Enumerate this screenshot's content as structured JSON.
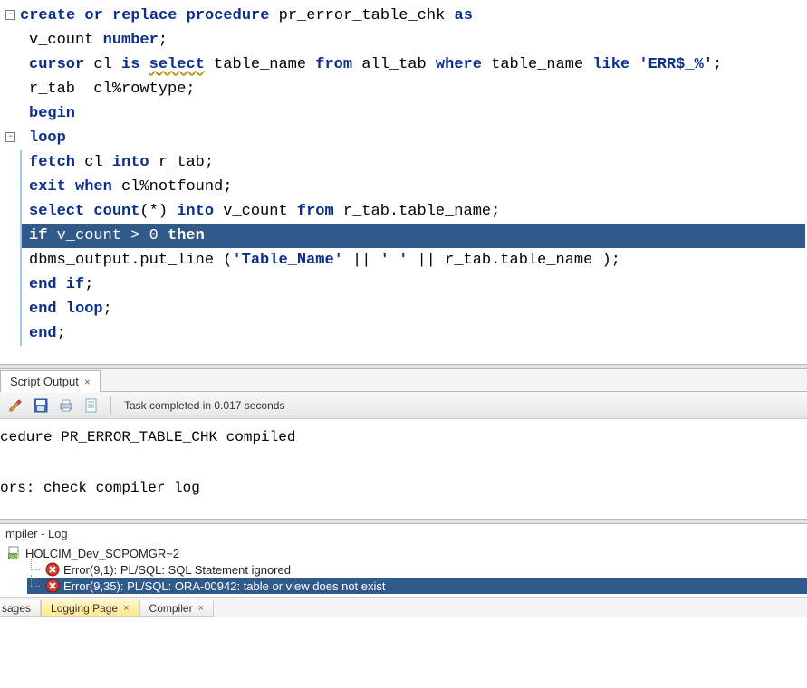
{
  "code": {
    "lines": [
      {
        "folds": true,
        "indent": false,
        "hl": false,
        "segments": [
          {
            "t": "create or replace procedure",
            "c": "kw"
          },
          {
            "t": " pr_error_table_chk "
          },
          {
            "t": "as",
            "c": "kw"
          }
        ]
      },
      {
        "indent": true,
        "hl": false,
        "segments": [
          {
            "t": "v_count "
          },
          {
            "t": "number",
            "c": "kw"
          },
          {
            "t": ";"
          }
        ]
      },
      {
        "indent": true,
        "hl": false,
        "segments": [
          {
            "t": "cursor",
            "c": "kw"
          },
          {
            "t": " cl "
          },
          {
            "t": "is",
            "c": "kw"
          },
          {
            "t": " "
          },
          {
            "t": "select",
            "c": "kw wavy"
          },
          {
            "t": " table_name "
          },
          {
            "t": "from",
            "c": "kw"
          },
          {
            "t": " all_tab "
          },
          {
            "t": "where",
            "c": "kw"
          },
          {
            "t": " table_name "
          },
          {
            "t": "like",
            "c": "kw"
          },
          {
            "t": " "
          },
          {
            "t": "'ERR$_%'",
            "c": "str"
          },
          {
            "t": ";"
          }
        ]
      },
      {
        "indent": true,
        "hl": false,
        "segments": [
          {
            "t": "r_tab  cl%rowtype;"
          }
        ]
      },
      {
        "indent": true,
        "hl": false,
        "segments": [
          {
            "t": "begin",
            "c": "kw"
          }
        ]
      },
      {
        "folds": true,
        "indent": true,
        "hl": false,
        "segments": [
          {
            "t": "loop",
            "c": "kw"
          }
        ]
      },
      {
        "indent": true,
        "hl": false,
        "bar": true,
        "segments": [
          {
            "t": "fetch",
            "c": "kw"
          },
          {
            "t": " cl "
          },
          {
            "t": "into",
            "c": "kw"
          },
          {
            "t": " r_tab;"
          }
        ]
      },
      {
        "indent": true,
        "hl": false,
        "bar": true,
        "segments": [
          {
            "t": "exit when",
            "c": "kw"
          },
          {
            "t": " cl%notfound;"
          }
        ]
      },
      {
        "indent": true,
        "hl": false,
        "bar": true,
        "segments": [
          {
            "t": "select count",
            "c": "kw"
          },
          {
            "t": "(*) "
          },
          {
            "t": "into",
            "c": "kw"
          },
          {
            "t": " v_count "
          },
          {
            "t": "from",
            "c": "kw"
          },
          {
            "t": " r_tab.table_name;"
          }
        ]
      },
      {
        "indent": true,
        "hl": true,
        "bar": true,
        "segments": [
          {
            "t": "if",
            "c": "kw"
          },
          {
            "t": " v_count > 0 "
          },
          {
            "t": "then",
            "c": "kw"
          }
        ]
      },
      {
        "indent": true,
        "hl": false,
        "bar": true,
        "segments": [
          {
            "t": "dbms_output.put_line ("
          },
          {
            "t": "'Table_Name'",
            "c": "str"
          },
          {
            "t": " || "
          },
          {
            "t": "' '",
            "c": "str"
          },
          {
            "t": " || r_tab.table_name );"
          }
        ]
      },
      {
        "indent": true,
        "hl": false,
        "bar": true,
        "segments": [
          {
            "t": "end if",
            "c": "kw"
          },
          {
            "t": ";"
          }
        ]
      },
      {
        "indent": true,
        "hl": false,
        "bar": true,
        "segments": [
          {
            "t": "end loop",
            "c": "kw"
          },
          {
            "t": ";"
          }
        ]
      },
      {
        "indent": true,
        "hl": false,
        "bar": true,
        "segments": [
          {
            "t": "end",
            "c": "kw"
          },
          {
            "t": ";"
          }
        ]
      }
    ]
  },
  "output": {
    "tab_label": "Script Output",
    "task_text": "Task completed in 0.017 seconds",
    "text": "cedure PR_ERROR_TABLE_CHK compiled\n\nors: check compiler log"
  },
  "compiler": {
    "title": "mpiler - Log",
    "root": "HOLCIM_Dev_SCPOMGR~2",
    "errors": [
      {
        "sel": false,
        "msg": "Error(9,1): PL/SQL: SQL Statement ignored"
      },
      {
        "sel": true,
        "msg": "Error(9,35): PL/SQL: ORA-00942: table or view does not exist"
      }
    ]
  },
  "bottom_tabs": {
    "tab1": "sages",
    "tab2": "Logging Page",
    "tab3": "Compiler"
  }
}
